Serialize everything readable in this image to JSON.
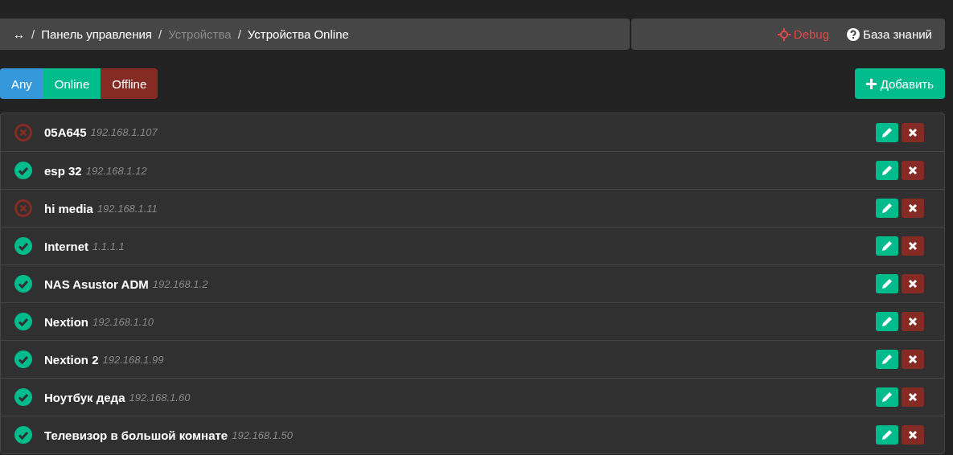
{
  "breadcrumb": {
    "home_icon": "↔",
    "items": [
      {
        "separator": "/",
        "label": "Панель управления",
        "disabled": false
      },
      {
        "separator": "/",
        "label": "Устройства",
        "disabled": true
      },
      {
        "separator": "/",
        "label": "Устройства Online",
        "disabled": false
      }
    ]
  },
  "top_links": [
    {
      "label": "Debug",
      "kind": "debug"
    },
    {
      "label": "База знаний",
      "kind": "help"
    }
  ],
  "filters": [
    {
      "label": "Any",
      "kind": "any"
    },
    {
      "label": "Online",
      "kind": "online"
    },
    {
      "label": "Offline",
      "kind": "offline"
    }
  ],
  "add_button": "Добавить",
  "devices": [
    {
      "name": "05A645",
      "ip": "192.168.1.107",
      "online": false
    },
    {
      "name": "esp 32",
      "ip": "192.168.1.12",
      "online": true
    },
    {
      "name": "hi media",
      "ip": "192.168.1.11",
      "online": false
    },
    {
      "name": "Internet",
      "ip": "1.1.1.1",
      "online": true
    },
    {
      "name": "NAS Asustor ADM",
      "ip": "192.168.1.2",
      "online": true
    },
    {
      "name": "Nextion",
      "ip": "192.168.1.10",
      "online": true
    },
    {
      "name": "Nextion 2",
      "ip": "192.168.1.99",
      "online": true
    },
    {
      "name": "Ноутбук деда",
      "ip": "192.168.1.60",
      "online": true
    },
    {
      "name": "Телевизор в большой комнате",
      "ip": "192.168.1.50",
      "online": true
    }
  ]
}
